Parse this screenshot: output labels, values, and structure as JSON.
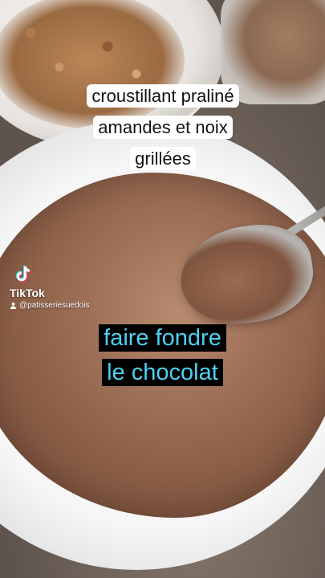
{
  "caption_top": {
    "line1": "croustillant praliné",
    "line2": "amandes et noix",
    "line3": "grillées"
  },
  "caption_overlay": {
    "line1": "faire fondre",
    "line2": "le chocolat"
  },
  "watermark": {
    "brand": "TikTok",
    "handle": "@patisseriesuedois",
    "icon": "tiktok-logo-icon"
  },
  "colors": {
    "overlay_text": "#4fd0f0",
    "overlay_bg": "#000000",
    "caption_bg": "#ffffff"
  }
}
